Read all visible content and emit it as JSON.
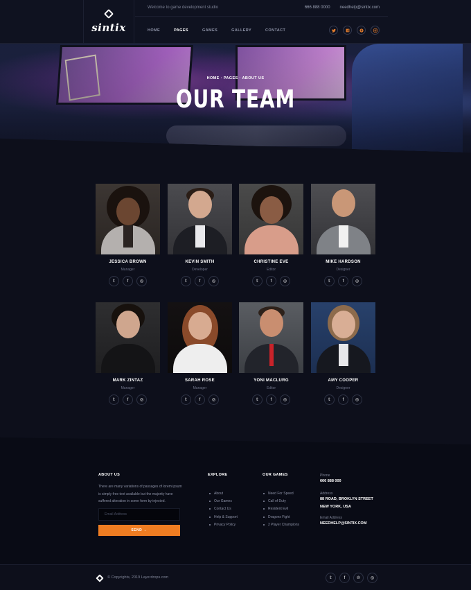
{
  "header": {
    "logo_text": "sintix",
    "welcome": "Welcome to game development studio",
    "phone": "666 888 0000",
    "email": "needhelp@sintix.com",
    "nav": [
      {
        "label": "Home",
        "active": false
      },
      {
        "label": "Pages",
        "active": true
      },
      {
        "label": "Games",
        "active": false
      },
      {
        "label": "Gallery",
        "active": false
      },
      {
        "label": "Contact",
        "active": false
      }
    ],
    "social": [
      "twitter-icon",
      "facebook-icon",
      "pinterest-icon",
      "instagram-icon"
    ],
    "accent": "#ef7d22"
  },
  "hero": {
    "breadcrumb": "HOME  ·  PAGES  ·  ABOUT US",
    "title": "OUR TEAM"
  },
  "team": [
    {
      "name": "Jessica Brown",
      "role": "Manager"
    },
    {
      "name": "Kevin Smith",
      "role": "Developer"
    },
    {
      "name": "Christine Eve",
      "role": "Editor"
    },
    {
      "name": "Mike Hardson",
      "role": "Designer"
    },
    {
      "name": "Mark Zintaz",
      "role": "Manager"
    },
    {
      "name": "Sarah Rose",
      "role": "Manager"
    },
    {
      "name": "Yoni Maclurg",
      "role": "Editor"
    },
    {
      "name": "Amy Cooper",
      "role": "Designer"
    }
  ],
  "footer": {
    "about_title": "About Us",
    "about_text": "There are many variations of passages of lorem ipsum is simply free text available but the majority have suffered alteration in some form by injected.",
    "email_placeholder": "Email Address",
    "send_label": "SEND",
    "explore_title": "Explore",
    "explore": [
      "About",
      "Our Games",
      "Contact Us",
      "Help & Support",
      "Privacy Policy"
    ],
    "games_title": "Our Games",
    "games": [
      "Need For Speed",
      "Call of Duty",
      "Resident Evil",
      "Dragons Fight",
      "2 Player Champions"
    ],
    "phone_label": "Phone",
    "phone": "666 888 000",
    "address_label": "Address",
    "address": "88 ROAD, BROKLYN STREET NEW YORK, USA",
    "email_label": "Email Address",
    "email": "NEEDHELP@SINTIX.COM",
    "copyright": "© Copyrights, 2019 Layerdrops.com"
  }
}
